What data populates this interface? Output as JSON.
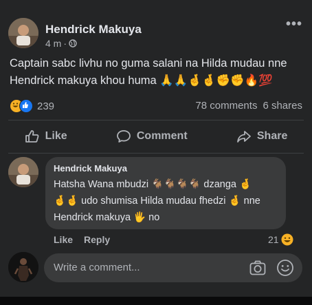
{
  "post": {
    "author": "Hendrick Makuya",
    "time": "4 m",
    "separator": "·",
    "text_line1": "Captain sabc livhu no guma salani na Hilda mudau nne",
    "text_line2": "Hendrick makuya khou huma",
    "text_emojis": "🙏🙏🤞🤞✊✊🔥💯",
    "reaction_count": "239",
    "comments": "78 comments",
    "shares": "6 shares"
  },
  "actions": {
    "like": "Like",
    "comment": "Comment",
    "share": "Share"
  },
  "comment": {
    "author": "Hendrick Makuya",
    "line1_text": "Hatsha Wana mbudzi",
    "line1_goats": "🐐🐐🐐🐐",
    "line1_end": "dzanga",
    "line1_emoji": "🤞",
    "line2_emoji": "🤞🤞",
    "line2_text": "udo shumisa Hilda mudau fhedzi",
    "line2_emoji2": "🤞",
    "line2_end": "nne",
    "line3_text": "Hendrick makuya",
    "line3_emoji": "🖐",
    "line3_end": "no",
    "like": "Like",
    "reply": "Reply",
    "reaction_count": "21"
  },
  "composer": {
    "placeholder": "Write a comment..."
  },
  "colors": {
    "background": "#242526",
    "bubble": "#3a3b3c",
    "text": "#e4e6eb",
    "secondary": "#b0b3b8",
    "like_blue": "#1877f2",
    "haha_yellow": "#f7b125"
  }
}
